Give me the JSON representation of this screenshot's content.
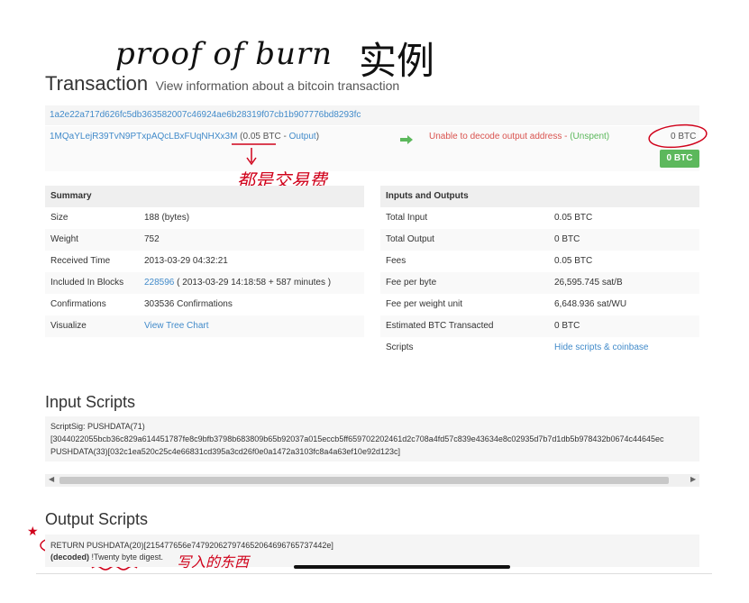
{
  "annotations": {
    "title_handwriting": "proof of burn",
    "title_chinese": "实例",
    "burn_note": "都是交易费",
    "return_note": "写入的东西",
    "star_mark": "★"
  },
  "header": {
    "title": "Transaction",
    "subtitle": "View information about a bitcoin transaction"
  },
  "tx": {
    "hash": "1a2e22a717d626fc5db363582007c46924ae6b28319f07cb1b907776bd8293fc",
    "input_address": "1MQaYLejR39TvN9PTxpAQcLBxFUqNHXx3M",
    "input_amount_open": " (0.05 BTC - ",
    "input_output_link": "Output",
    "input_amount_close": ")",
    "output_error": "Unable to decode output address - ",
    "output_status": "(Unspent)",
    "output_amount": "0 BTC",
    "total_button": "0 BTC"
  },
  "summary": {
    "heading": "Summary",
    "rows": [
      {
        "label": "Size",
        "value": "188 (bytes)"
      },
      {
        "label": "Weight",
        "value": "752"
      },
      {
        "label": "Received Time",
        "value": "2013-03-29 04:32:21"
      },
      {
        "label": "Included In Blocks",
        "value_link": "228596",
        "value": " ( 2013-03-29 14:18:58 + 587 minutes )"
      },
      {
        "label": "Confirmations",
        "value": "303536 Confirmations"
      },
      {
        "label": "Visualize",
        "value_link": "View Tree Chart"
      }
    ]
  },
  "io": {
    "heading": "Inputs and Outputs",
    "rows": [
      {
        "label": "Total Input",
        "value": "0.05 BTC"
      },
      {
        "label": "Total Output",
        "value": "0 BTC"
      },
      {
        "label": "Fees",
        "value": "0.05 BTC"
      },
      {
        "label": "Fee per byte",
        "value": "26,595.745 sat/B"
      },
      {
        "label": "Fee per weight unit",
        "value": "6,648.936 sat/WU"
      },
      {
        "label": "Estimated BTC Transacted",
        "value": "0 BTC"
      },
      {
        "label": "Scripts",
        "value_link": "Hide scripts & coinbase"
      }
    ]
  },
  "input_scripts": {
    "heading": "Input Scripts",
    "line1": "ScriptSig: PUSHDATA(71)",
    "line2": "[3044022055bcb36c829a614451787fe8c9bfb3798b683809b65b92037a015eccb5ff659702202461d2c708a4fd57c839e43634e8c02935d7b7d1db5b978432b0674c44645ec",
    "line3": "PUSHDATA(33)[032c1ea520c25c4e66831cd395a3cd26f0e0a1472a3103fc8a4a63ef10e92d123c]"
  },
  "output_scripts": {
    "heading": "Output Scripts",
    "return_op": "RETURN",
    "pushdata": " PUSHDATA(20)[215477656e747920627974652064696765737442e]",
    "decoded_label": "(decoded)",
    "decoded_value": " !Twenty byte digest."
  },
  "colors": {
    "link": "#428bca",
    "green": "#5cb85c",
    "error_red": "#d9534f",
    "annotation_red": "#d0021b"
  }
}
